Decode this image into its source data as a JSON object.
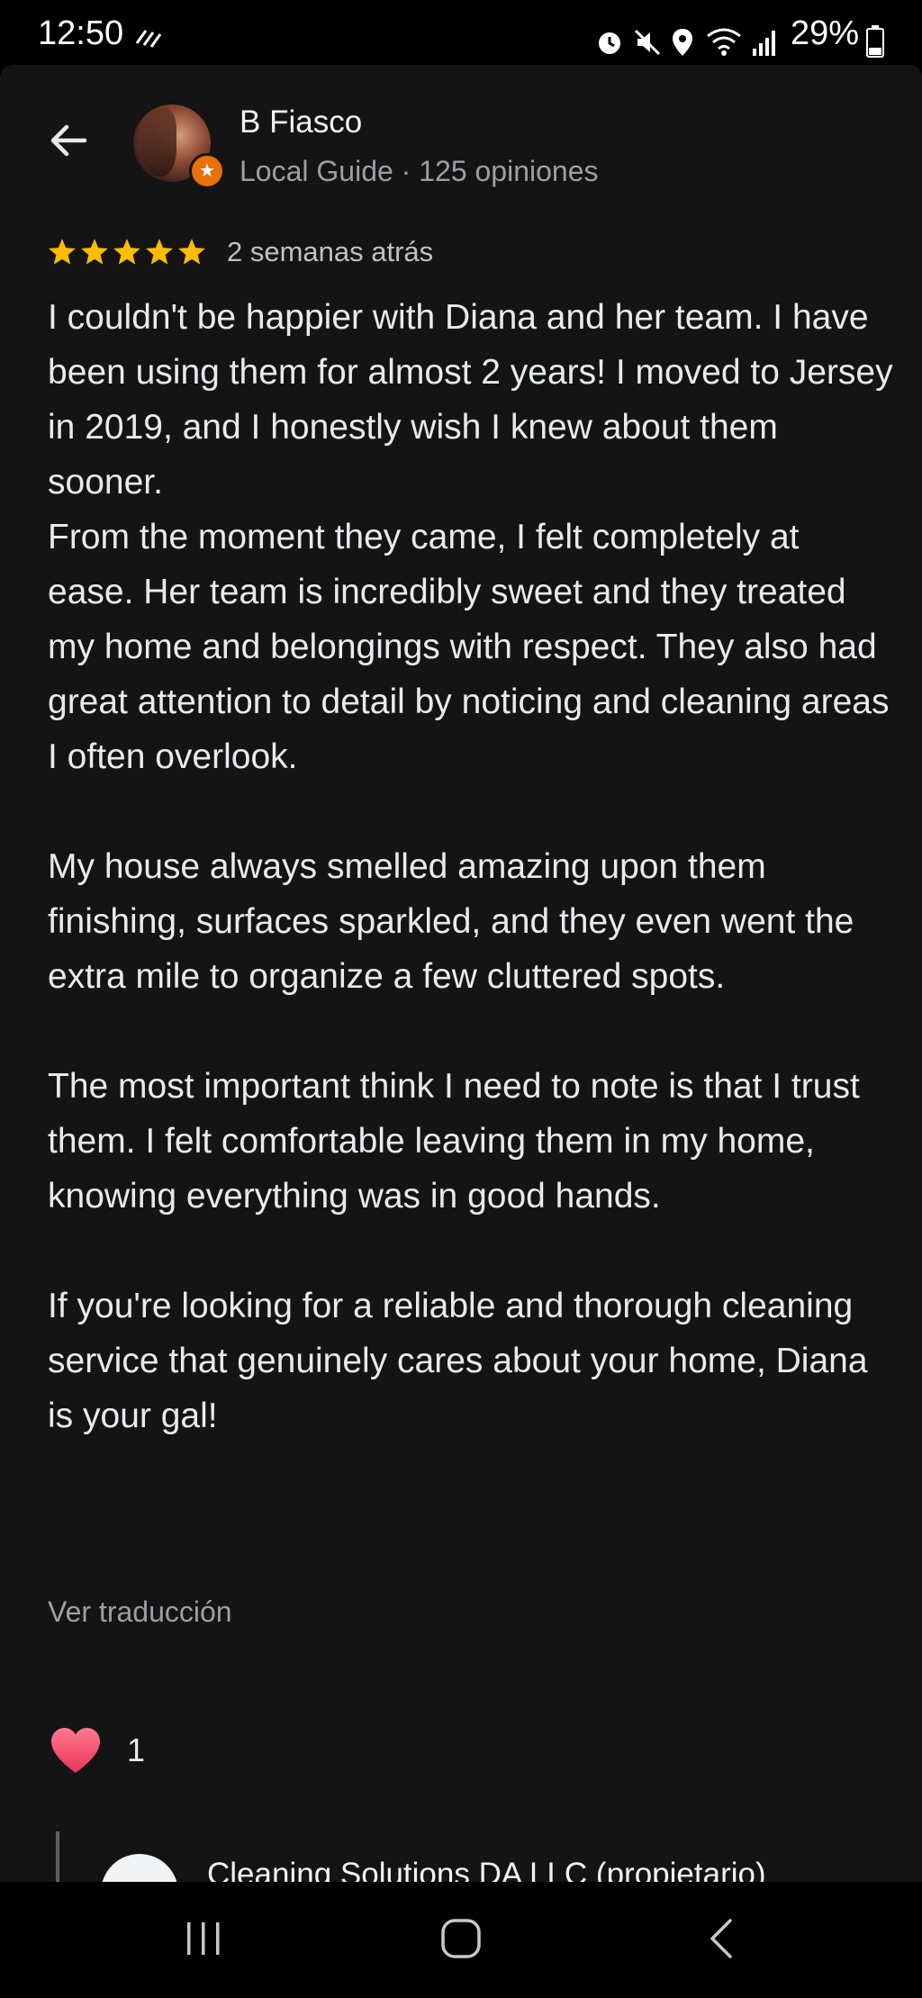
{
  "status_bar": {
    "time": "12:50",
    "battery": "29%",
    "icons": [
      "alarm-icon",
      "mute-icon",
      "location-icon",
      "wifi-icon",
      "signal-icon",
      "battery-icon"
    ]
  },
  "reviewer": {
    "name": "B Fiasco",
    "meta": "Local Guide · 125 opiniones"
  },
  "review": {
    "rating": 5,
    "date": "2 semanas atrás",
    "paragraphs": [
      "I couldn't be happier with Diana and her team. I have been using them for almost 2 years! I moved to Jersey in 2019, and I honestly wish I knew about them sooner.\nFrom the moment they came, I felt completely at ease. Her team is incredibly sweet and they treated my home and belongings with respect. They also had great attention to detail by noticing and cleaning areas I often overlook.",
      "My house always smelled amazing upon them finishing, surfaces sparkled, and they even went the extra mile to organize a few cluttered spots.",
      "The most important think I need to note is that I trust them. I felt comfortable leaving them in my home, knowing everything was in good hands.",
      "If you're looking for a reliable and thorough cleaning service that genuinely cares about your home, Diana is your gal!"
    ],
    "translate_label": "Ver traducción",
    "like_count": "1"
  },
  "owner_reply": {
    "name": "Cleaning Solutions DA LLC (propietario)"
  },
  "colors": {
    "background": "#141414",
    "star": "#fbbc04",
    "heart": "#f0506e",
    "badge": "#e8710a"
  }
}
